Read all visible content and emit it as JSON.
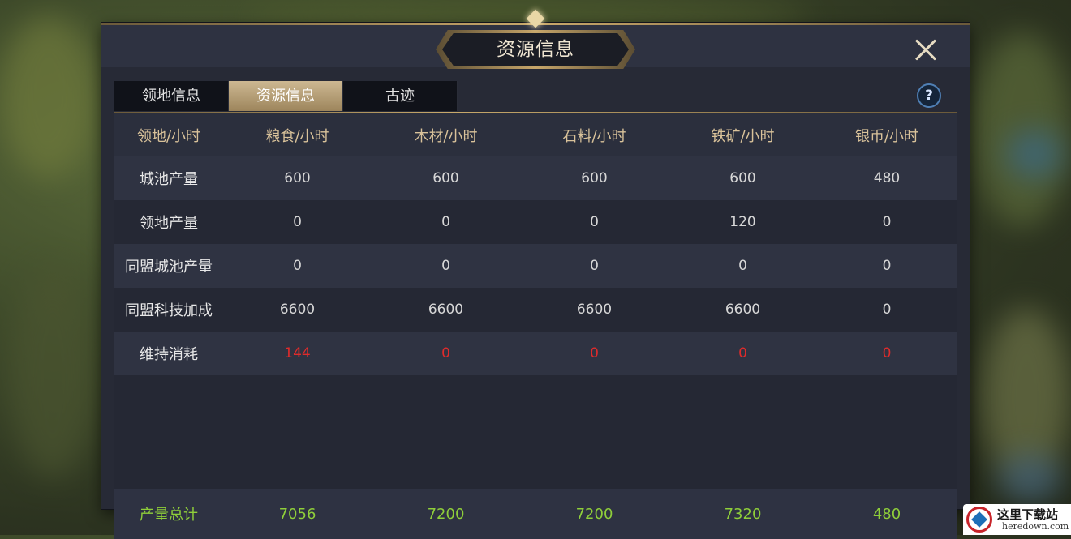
{
  "window": {
    "title": "资源信息",
    "close_icon": "close-icon",
    "help_icon_text": "?"
  },
  "tabs": [
    {
      "label": "领地信息",
      "active": false
    },
    {
      "label": "资源信息",
      "active": true
    },
    {
      "label": "古迹",
      "active": false
    }
  ],
  "table": {
    "headers": [
      "领地/小时",
      "粮食/小时",
      "木材/小时",
      "石料/小时",
      "铁矿/小时",
      "银币/小时"
    ],
    "rows": [
      {
        "label": "城池产量",
        "values": [
          "600",
          "600",
          "600",
          "600",
          "480"
        ]
      },
      {
        "label": "领地产量",
        "values": [
          "0",
          "0",
          "0",
          "120",
          "0"
        ]
      },
      {
        "label": "同盟城池产量",
        "values": [
          "0",
          "0",
          "0",
          "0",
          "0"
        ]
      },
      {
        "label": "同盟科技加成",
        "values": [
          "6600",
          "6600",
          "6600",
          "6600",
          "0"
        ]
      },
      {
        "label": "维持消耗",
        "values": [
          "144",
          "0",
          "0",
          "0",
          "0"
        ]
      }
    ],
    "total": {
      "label": "产量总计",
      "values": [
        "7056",
        "7200",
        "7200",
        "7320",
        "480"
      ]
    }
  },
  "colors": {
    "accent_gold": "#c8a96b",
    "consumption_red": "#e02b2b",
    "total_green": "#8fcf3a"
  },
  "watermark": {
    "title": "这里下载站",
    "subtitle": "heredown.com"
  }
}
